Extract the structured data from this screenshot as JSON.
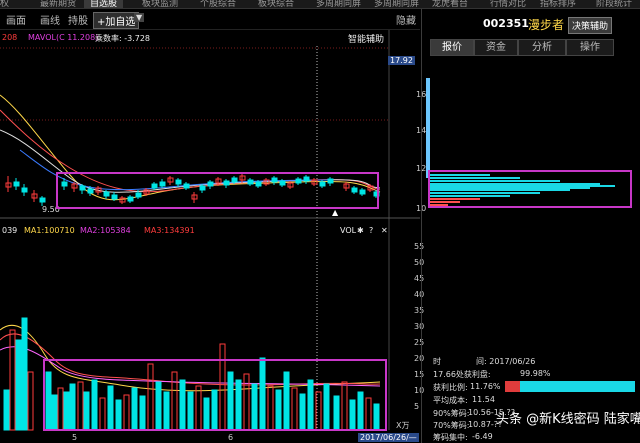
{
  "topnav": {
    "tabs": [
      "权",
      "最新期货",
      "自选股",
      "板块监测",
      "个股综合",
      "板块综合",
      "多周期同屏",
      "多周期同屏",
      "龙虎看台",
      "行情对比",
      "指标排序",
      "阶段统计"
    ],
    "active_index": 2
  },
  "toolbar": {
    "picture": "画面",
    "line": "画线",
    "hold": "持股",
    "add_watch": "+加自选",
    "hide": "隐藏"
  },
  "indicators": {
    "top_vals": "208",
    "mavol_label": "MAVOL(C 11.208)",
    "chip_label": "乘数率: -3.728",
    "smart_aux": "智能辅助"
  },
  "vol_indicators": {
    "v039": "039",
    "ma1": "MA1:100710",
    "ma2": "MA2:105384",
    "ma3": "MA3:134391",
    "vol_label": "VOL"
  },
  "price_axis": {
    "labels": [
      "16",
      "14",
      "12",
      "10"
    ],
    "current_price": "17.92",
    "low_marker": "9.50"
  },
  "vol_axis": {
    "labels": [
      "55",
      "50",
      "45",
      "40",
      "35",
      "30",
      "25",
      "20",
      "15",
      "10",
      "5"
    ],
    "unit": "X万"
  },
  "date_axis": {
    "labels": [
      "5",
      "6"
    ],
    "current_date": "2017/06/26/—"
  },
  "right_panel": {
    "code": "002351",
    "name": "漫步者",
    "decision_btn": "决策辅助",
    "tabs": [
      "报价",
      "资金",
      "分析",
      "操作"
    ],
    "active_tab": 0,
    "stats": [
      {
        "label": "时",
        "value": "间: 2017/06/26"
      },
      {
        "label": "17.66处获利盘:",
        "value": "99.98%"
      },
      {
        "label": "获利比例:",
        "value": "11.76%"
      },
      {
        "label": "平均成本:",
        "value": "11.54"
      },
      {
        "label": "90%筹码:",
        "value": "10.56-15.??"
      },
      {
        "label": "70%筹码:",
        "value": "10.87-??"
      },
      {
        "label": "筹码集中:",
        "value": "-6.49"
      }
    ],
    "profit_ratio": 0.1176
  },
  "watermark": "头条 @新K线密码  陆家嘴大牛",
  "colors": {
    "up": "#ff3c3c",
    "down": "#00e5e5",
    "box": "#c837c8",
    "ma_yellow": "#ffd84a"
  }
}
